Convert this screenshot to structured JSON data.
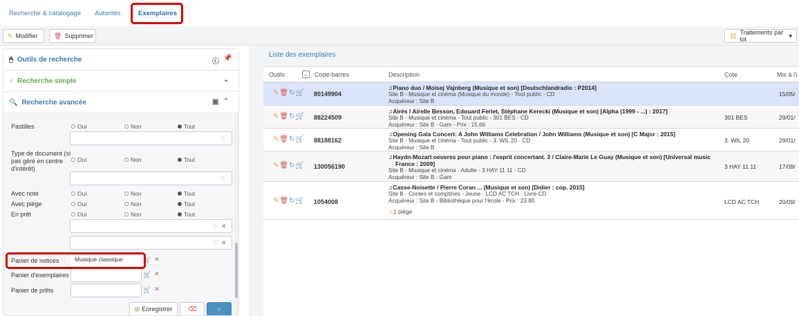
{
  "top_tabs": [
    "Recherche & catalogage",
    "Autorités",
    "Exemplaires"
  ],
  "toolbar": {
    "modify_label": "Modifier",
    "delete_label": "Supprimer",
    "batch_label": "Traitements par lot"
  },
  "left": {
    "sections": {
      "tools": "Outils de recherche",
      "simple": "Recherche simple",
      "advanced": "Recherche avancée"
    },
    "fields": {
      "pastilles": "Pastilles",
      "doc_type": "Type de document (si pas géré en centre d'intérêt)",
      "avec_note": "Avec note",
      "avec_piege": "Avec piège",
      "en_pret": "En prêt",
      "panier_notices": "Panier de notices",
      "panier_exemplaires": "Panier d'exemplaires",
      "panier_prets": "Panier de prêts"
    },
    "radio": {
      "oui": "Oui",
      "non": "Non",
      "tout": "Tout"
    },
    "panier_notices_value": "Musique classique",
    "save_label": "Enregistrer"
  },
  "right": {
    "title": "Liste des exemplaires",
    "columns": [
      "Outils",
      "Code-barres",
      "Description",
      "Cote",
      "Mis à l'i"
    ],
    "rows": [
      {
        "barcode": "80149904",
        "title": "Piano duo / Moisej Vajnberg (Musique et son) [Deutschlandradio : P2014]",
        "line2": "Site B - Musique et cinéma (Musique du monde) - Tout public - CD",
        "line3": "Acquéreur : Site B",
        "cote": "",
        "date": "15/05/"
      },
      {
        "barcode": "88224509",
        "title": "Airés / Airelle Besson, Edouard Ferlet, Stéphane Kerecki (Musique et son) [Alpha (1999 - ...) : 2017]",
        "line2": "Site B - Musique et cinéma - Tout public - 301 BES - CD",
        "line3": "Acquéreur : Site B - Gam - Prix : 15.66",
        "cote": "301 BES",
        "date": "29/01/"
      },
      {
        "barcode": "88188162",
        "title": "Opening Gala Concert: A John Williams Celebration / John Williams (Musique et son) [C Major : 2015]",
        "line2": "Site B - Musique et cinéma - Tout public - 3. WIL 20 - CD",
        "line3": "Acquéreur : Site B",
        "cote": "3. WIL 20",
        "date": "29/01/"
      },
      {
        "barcode": "130056190",
        "title": "Haydn-Mozart oeuvres pour piano : l'esprit concertant. 3 / Claire-Marie Le Guay (Musique et son) [Universal music",
        "title2": "France : 2009]",
        "line2": "Site B - Musique et cinéma - Adulte - 3 HAY 11 11 - CD",
        "line3": "Acquéreur : Site B - Gam",
        "cote": "3 HAY 11 11",
        "date": "17/09/"
      },
      {
        "barcode": "1054008",
        "title": "Casse-Noisette / Pierre Coran ... (Musique et son) [Didier : cop. 2015]",
        "line2": "Site B - Contes et comptines - Jeune - LCD AC TCH - Livre-CD",
        "line3": "Acquéreur : Site B - Bibliothèque pour l'école - Prix : 23.80",
        "warning": "1 piège",
        "cote": "LCD AC TCH",
        "date": "20/09/"
      }
    ]
  }
}
